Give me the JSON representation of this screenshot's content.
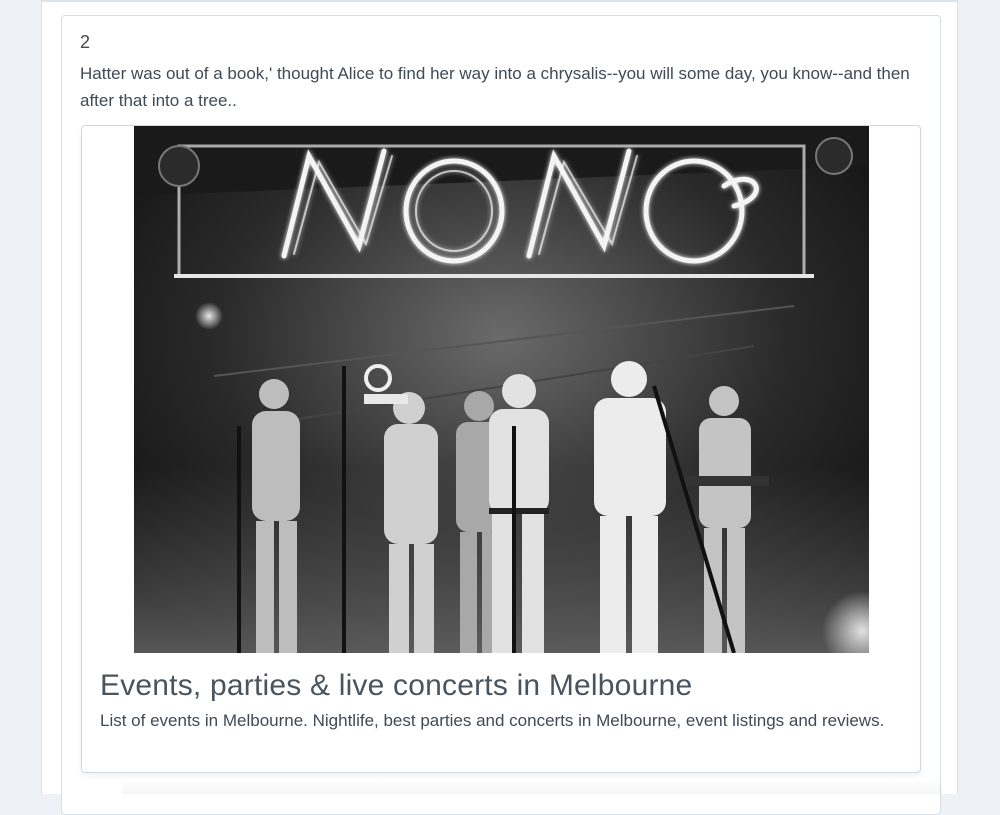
{
  "post": {
    "number": "2",
    "text": "Hatter was out of a book,' thought Alice to find her way into a chrysalis--you will some day, you know--and then after that into a tree.."
  },
  "link_preview": {
    "image_alt": "Band performing on stage under a neon sign",
    "neon_sign_text": "NONO",
    "title": "Events, parties & live concerts in Melbourne",
    "description": "List of events in Melbourne. Nightlife, best parties and concerts in Melbourne, event listings and reviews."
  }
}
